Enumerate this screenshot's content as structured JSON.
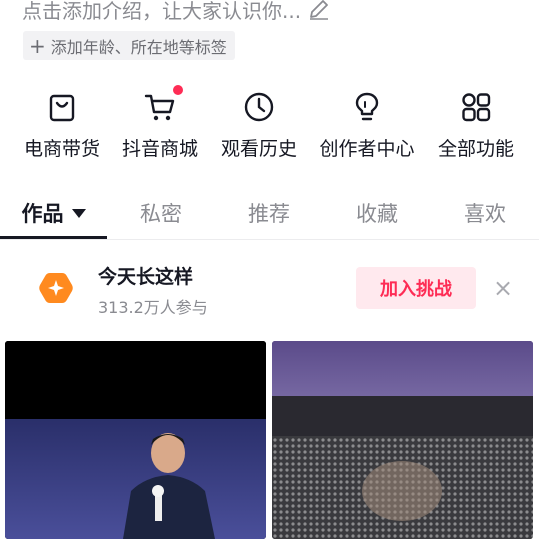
{
  "profile": {
    "intro_text": "点击添加介绍，让大家认识你...",
    "tag_prompt": "添加年龄、所在地等标签"
  },
  "shortcuts": [
    {
      "label": "电商带货",
      "icon": "shopping-bag-icon"
    },
    {
      "label": "抖音商城",
      "icon": "shopping-cart-icon",
      "has_dot": true
    },
    {
      "label": "观看历史",
      "icon": "clock-icon"
    },
    {
      "label": "创作者中心",
      "icon": "lightbulb-icon"
    },
    {
      "label": "全部功能",
      "icon": "grid-icon"
    }
  ],
  "tabs": [
    {
      "label": "作品",
      "active": true
    },
    {
      "label": "私密"
    },
    {
      "label": "推荐"
    },
    {
      "label": "收藏"
    },
    {
      "label": "喜欢"
    }
  ],
  "challenge": {
    "title": "今天长这样",
    "participants": "313.2万人参与",
    "join_label": "加入挑战",
    "close_label": "×"
  },
  "colors": {
    "accent": "#fe2c55",
    "challenge_icon": "#ff8a1f",
    "muted_text": "#8a8b91"
  }
}
